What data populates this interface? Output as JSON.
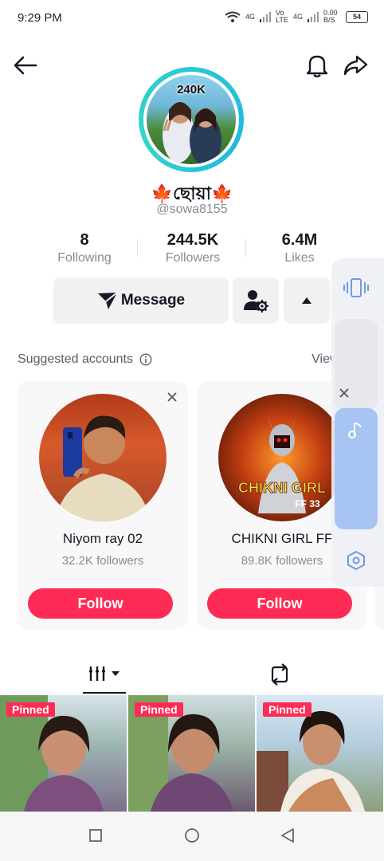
{
  "status_bar": {
    "time": "9:29 PM",
    "network_1": "4G",
    "network_2": "Vo LTE",
    "network_3": "4G",
    "speed": "0.00 B/S",
    "battery": "54"
  },
  "profile": {
    "avatar_overlay": "240K",
    "display_name": "🍁ছোয়া🍁",
    "username": "@sowa8155",
    "stats": [
      {
        "value": "8",
        "label": "Following"
      },
      {
        "value": "244.5K",
        "label": "Followers"
      },
      {
        "value": "6.4M",
        "label": "Likes"
      }
    ],
    "message_label": "Message"
  },
  "suggested": {
    "title": "Suggested accounts",
    "view_all": "View all",
    "cards": [
      {
        "name": "Niyom ray 02",
        "followers": "32.2K followers",
        "follow_label": "Follow"
      },
      {
        "name": "CHIKNI GIRL FF",
        "followers": "89.8K followers",
        "follow_label": "Follow",
        "pic_text_1": "CHIKNI GIRL",
        "pic_text_2": "FF 33"
      }
    ]
  },
  "videos": [
    {
      "badge": "Pinned"
    },
    {
      "badge": "Pinned"
    },
    {
      "badge": "Pinned"
    }
  ],
  "colors": {
    "accent": "#fe2c55",
    "avatar_ring": "#28c9d6",
    "side_blue": "#a8c4f2"
  },
  "icons": [
    "back-arrow-icon",
    "bell-icon",
    "share-icon",
    "message-send-icon",
    "add-friend-gear-icon",
    "caret-up-icon",
    "info-icon",
    "chevron-right-icon",
    "close-icon",
    "grid-videos-icon",
    "repost-icon",
    "vibrate-icon",
    "music-note-icon",
    "hexagon-icon",
    "square-nav-icon",
    "circle-nav-icon",
    "back-triangle-nav-icon"
  ]
}
